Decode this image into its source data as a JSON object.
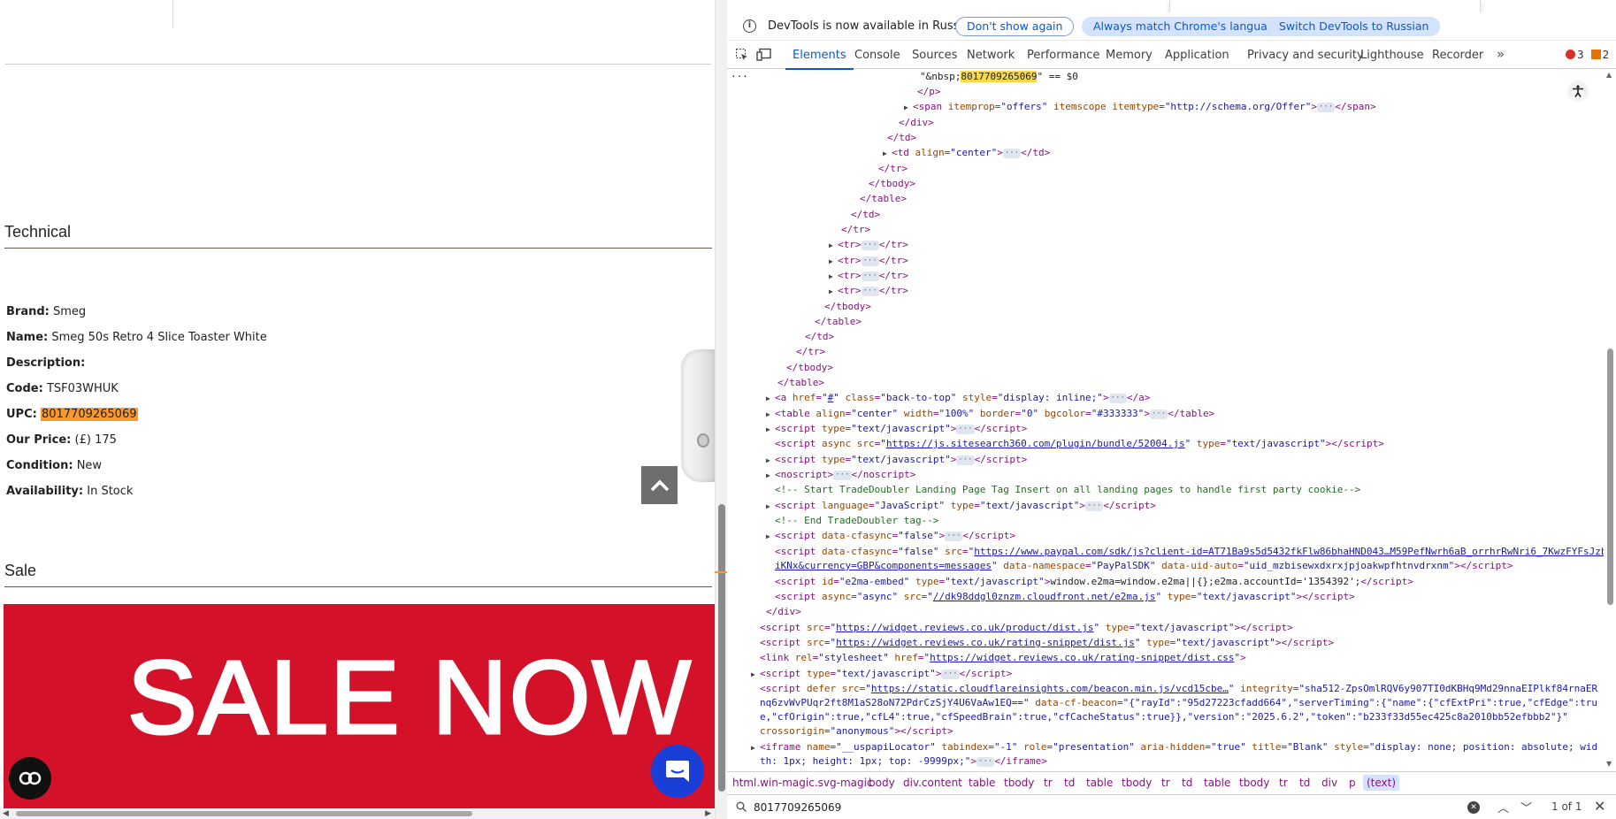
{
  "page": {
    "sections": {
      "technical": "Technical",
      "sale": "Sale"
    },
    "details": [
      {
        "label": "Brand:",
        "value": "Smeg"
      },
      {
        "label": "Name:",
        "value": "Smeg 50s Retro 4 Slice Toaster White"
      },
      {
        "label": "Description:",
        "value": ""
      },
      {
        "label": "Code:",
        "value": "TSF03WHUK"
      },
      {
        "label": "UPC:",
        "value": "8017709265069"
      },
      {
        "label": "Our Price:",
        "value": "(£) 175"
      },
      {
        "label": "Condition:",
        "value": "New"
      },
      {
        "label": "Availability:",
        "value": "In Stock"
      }
    ],
    "banner_text": "SALE NOW O",
    "colors": {
      "banner": "#d3122a",
      "chat": "#1a3fd7",
      "upc_highlight": "#f9982b"
    }
  },
  "devtools": {
    "infobar": {
      "message": "DevTools is now available in Russian",
      "dont_show": "Don't show again",
      "always_match": "Always match Chrome's language",
      "switch": "Switch DevTools to Russian"
    },
    "tabs": [
      "Elements",
      "Console",
      "Sources",
      "Network",
      "Performance",
      "Memory",
      "Application",
      "Privacy and security",
      "Lighthouse",
      "Recorder"
    ],
    "errors": "3",
    "warnings": "2",
    "breadcrumbs": [
      "html.win-magic.svg-magic",
      "body",
      "div.content",
      "table",
      "tbody",
      "tr",
      "td",
      "table",
      "tbody",
      "tr",
      "td",
      "table",
      "tbody",
      "tr",
      "td",
      "div",
      "p",
      "(text)"
    ],
    "search": {
      "query": "8017709265069",
      "count": "1 of 1"
    }
  }
}
